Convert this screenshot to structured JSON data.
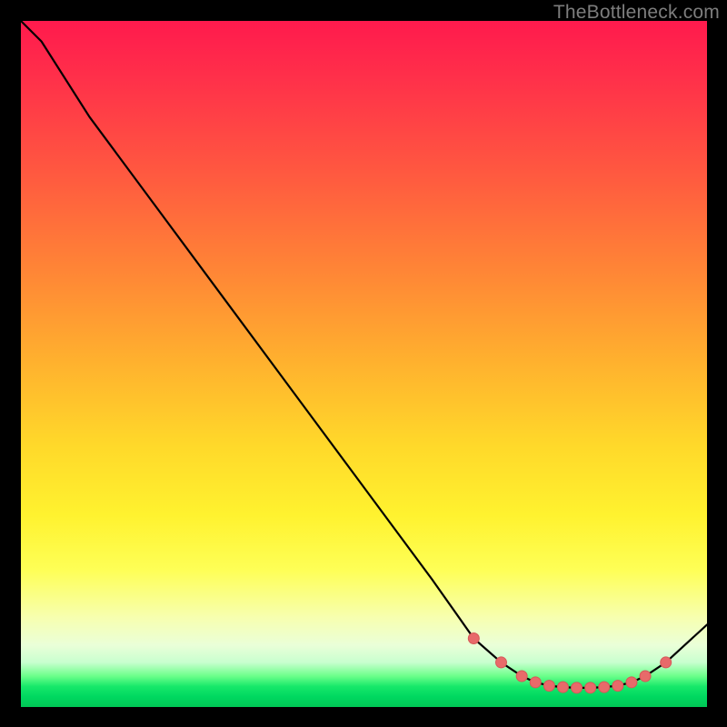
{
  "watermark": "TheBottleneck.com",
  "colors": {
    "curve_stroke": "#000000",
    "marker_fill": "#e86a6a",
    "marker_stroke": "#d65858"
  },
  "chart_data": {
    "type": "line",
    "title": "",
    "xlabel": "",
    "ylabel": "",
    "xlim": [
      0,
      100
    ],
    "ylim": [
      0,
      100
    ],
    "x": [
      0,
      3,
      10,
      20,
      30,
      40,
      50,
      60,
      66,
      70,
      73,
      75,
      77,
      79,
      81,
      83,
      85,
      87,
      89,
      91,
      94,
      100
    ],
    "values": [
      100,
      97,
      86,
      72.5,
      59,
      45.5,
      32,
      18.5,
      10,
      6.5,
      4.5,
      3.6,
      3.1,
      2.9,
      2.8,
      2.8,
      2.9,
      3.1,
      3.6,
      4.5,
      6.5,
      12
    ],
    "markers_x": [
      66,
      70,
      73,
      75,
      77,
      79,
      81,
      83,
      85,
      87,
      89,
      91,
      94
    ],
    "markers_y": [
      10,
      6.5,
      4.5,
      3.6,
      3.1,
      2.9,
      2.8,
      2.8,
      2.9,
      3.1,
      3.6,
      4.5,
      6.5
    ]
  }
}
